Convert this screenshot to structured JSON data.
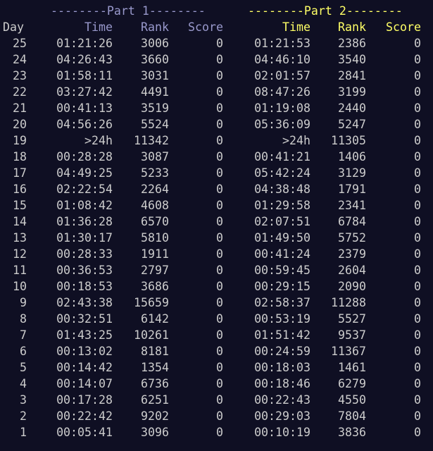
{
  "part_headers": {
    "part1": "--------Part 1--------",
    "part2": "--------Part 2--------"
  },
  "columns": {
    "day": "Day",
    "part1": [
      "Time",
      "Rank",
      "Score"
    ],
    "part2": [
      "Time",
      "Rank",
      "Score"
    ]
  },
  "rows": [
    {
      "day": "25",
      "p1": [
        "01:21:26",
        "3006",
        "0"
      ],
      "p2": [
        "01:21:53",
        "2386",
        "0"
      ]
    },
    {
      "day": "24",
      "p1": [
        "04:26:43",
        "3660",
        "0"
      ],
      "p2": [
        "04:46:10",
        "3540",
        "0"
      ]
    },
    {
      "day": "23",
      "p1": [
        "01:58:11",
        "3031",
        "0"
      ],
      "p2": [
        "02:01:57",
        "2841",
        "0"
      ]
    },
    {
      "day": "22",
      "p1": [
        "03:27:42",
        "4491",
        "0"
      ],
      "p2": [
        "08:47:26",
        "3199",
        "0"
      ]
    },
    {
      "day": "21",
      "p1": [
        "00:41:13",
        "3519",
        "0"
      ],
      "p2": [
        "01:19:08",
        "2440",
        "0"
      ]
    },
    {
      "day": "20",
      "p1": [
        "04:56:26",
        "5524",
        "0"
      ],
      "p2": [
        "05:36:09",
        "5247",
        "0"
      ]
    },
    {
      "day": "19",
      "p1": [
        ">24h",
        "11342",
        "0"
      ],
      "p2": [
        ">24h",
        "11305",
        "0"
      ]
    },
    {
      "day": "18",
      "p1": [
        "00:28:28",
        "3087",
        "0"
      ],
      "p2": [
        "00:41:21",
        "1406",
        "0"
      ]
    },
    {
      "day": "17",
      "p1": [
        "04:49:25",
        "5233",
        "0"
      ],
      "p2": [
        "05:42:24",
        "3129",
        "0"
      ]
    },
    {
      "day": "16",
      "p1": [
        "02:22:54",
        "2264",
        "0"
      ],
      "p2": [
        "04:38:48",
        "1791",
        "0"
      ]
    },
    {
      "day": "15",
      "p1": [
        "01:08:42",
        "4608",
        "0"
      ],
      "p2": [
        "01:29:58",
        "2341",
        "0"
      ]
    },
    {
      "day": "14",
      "p1": [
        "01:36:28",
        "6570",
        "0"
      ],
      "p2": [
        "02:07:51",
        "6784",
        "0"
      ]
    },
    {
      "day": "13",
      "p1": [
        "01:30:17",
        "5810",
        "0"
      ],
      "p2": [
        "01:49:50",
        "5752",
        "0"
      ]
    },
    {
      "day": "12",
      "p1": [
        "00:28:33",
        "1911",
        "0"
      ],
      "p2": [
        "00:41:24",
        "2379",
        "0"
      ]
    },
    {
      "day": "11",
      "p1": [
        "00:36:53",
        "2797",
        "0"
      ],
      "p2": [
        "00:59:45",
        "2604",
        "0"
      ]
    },
    {
      "day": "10",
      "p1": [
        "00:18:53",
        "3686",
        "0"
      ],
      "p2": [
        "00:29:15",
        "2090",
        "0"
      ]
    },
    {
      "day": "9",
      "p1": [
        "02:43:38",
        "15659",
        "0"
      ],
      "p2": [
        "02:58:37",
        "11288",
        "0"
      ]
    },
    {
      "day": "8",
      "p1": [
        "00:32:51",
        "6142",
        "0"
      ],
      "p2": [
        "00:53:19",
        "5527",
        "0"
      ]
    },
    {
      "day": "7",
      "p1": [
        "01:43:25",
        "10261",
        "0"
      ],
      "p2": [
        "01:51:42",
        "9537",
        "0"
      ]
    },
    {
      "day": "6",
      "p1": [
        "00:13:02",
        "8181",
        "0"
      ],
      "p2": [
        "00:24:59",
        "11367",
        "0"
      ]
    },
    {
      "day": "5",
      "p1": [
        "00:14:42",
        "1354",
        "0"
      ],
      "p2": [
        "00:18:03",
        "1461",
        "0"
      ]
    },
    {
      "day": "4",
      "p1": [
        "00:14:07",
        "6736",
        "0"
      ],
      "p2": [
        "00:18:46",
        "6279",
        "0"
      ]
    },
    {
      "day": "3",
      "p1": [
        "00:17:28",
        "6251",
        "0"
      ],
      "p2": [
        "00:22:43",
        "4550",
        "0"
      ]
    },
    {
      "day": "2",
      "p1": [
        "00:22:42",
        "9202",
        "0"
      ],
      "p2": [
        "00:29:03",
        "7804",
        "0"
      ]
    },
    {
      "day": "1",
      "p1": [
        "00:05:41",
        "3096",
        "0"
      ],
      "p2": [
        "00:10:19",
        "3836",
        "0"
      ]
    }
  ]
}
